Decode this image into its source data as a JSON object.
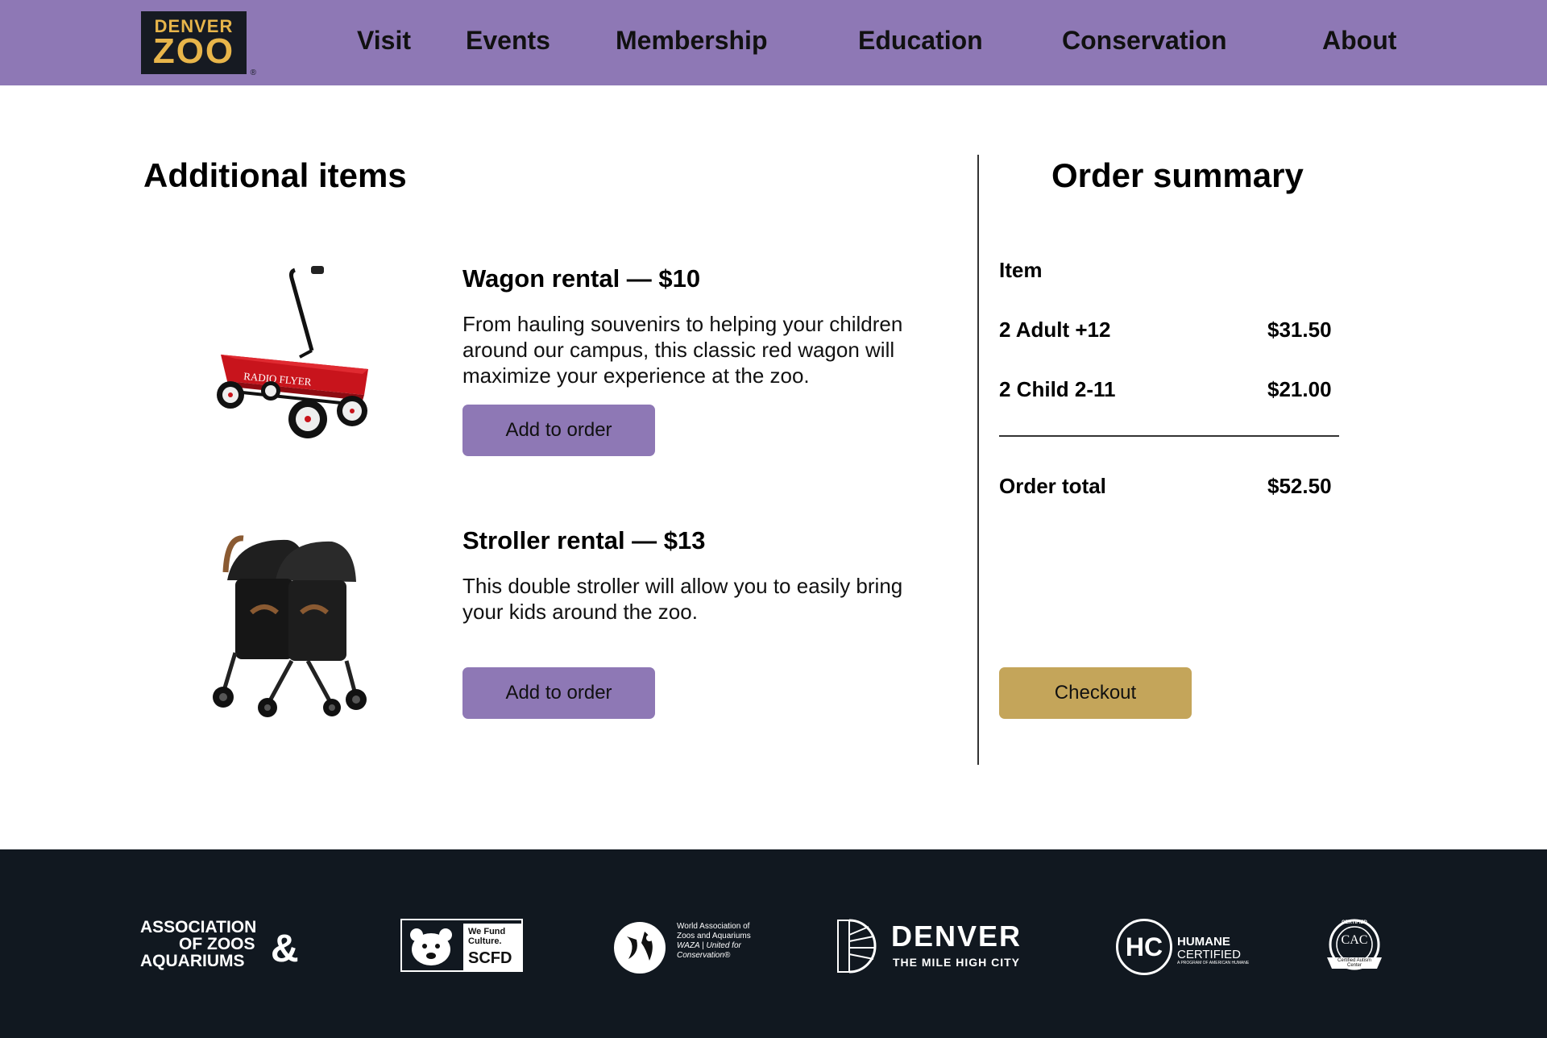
{
  "brand": {
    "logo_top": "DENVER",
    "logo_bottom": "ZOO",
    "logo_tm": "®"
  },
  "nav": {
    "items": [
      {
        "label": "Visit"
      },
      {
        "label": "Events"
      },
      {
        "label": "Membership"
      },
      {
        "label": "Education"
      },
      {
        "label": "Conservation"
      },
      {
        "label": "About"
      }
    ]
  },
  "additional": {
    "title": "Additional items",
    "items": [
      {
        "title": "Wagon rental — $10",
        "description": "From hauling souvenirs to helping your children around our campus, this classic red wagon will maximize your experience at the zoo.",
        "button": "Add to order"
      },
      {
        "title": "Stroller rental — $13",
        "description": "This double stroller will allow you to easily bring your kids around the zoo.",
        "button": "Add to order"
      }
    ]
  },
  "summary": {
    "title": "Order summary",
    "header": "Item",
    "lines": [
      {
        "label": "2 Adult +12",
        "price": "$31.50"
      },
      {
        "label": "2 Child 2-11",
        "price": "$21.00"
      }
    ],
    "total_label": "Order total",
    "total_price": "$52.50",
    "checkout": "Checkout"
  },
  "footer": {
    "aza": [
      "ASSOCIATION",
      "OF ZOOS",
      "AQUARIUMS",
      "&"
    ],
    "scfd": [
      "We Fund",
      "Culture.",
      "SCFD"
    ],
    "waza": [
      "World Association of",
      "Zoos and Aquariums",
      "WAZA | United for",
      "Conservation®"
    ],
    "denver": [
      "DENVER",
      "THE MILE HIGH CITY"
    ],
    "humane": [
      "HC",
      "HUMANE",
      "CERTIFIED",
      "A PROGRAM OF AMERICAN HUMANE"
    ],
    "cac": [
      "CAC",
      "CERTIFIED",
      "Certified Autism",
      "Center"
    ]
  },
  "colors": {
    "header_bg": "#8e78b5",
    "button_purple": "#8e78b5",
    "checkout_gold": "#c4a55a",
    "footer_bg": "#111820",
    "logo_gold": "#e8b54a"
  }
}
